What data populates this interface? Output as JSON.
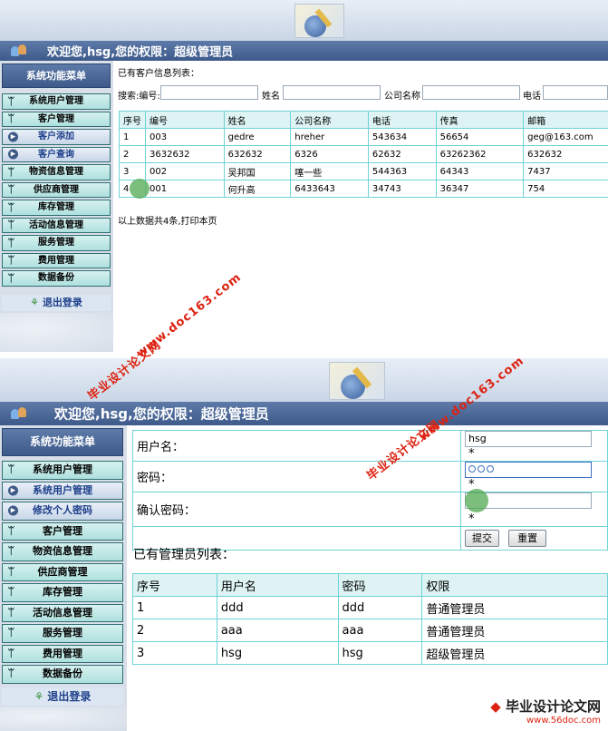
{
  "top": {
    "welcome": "欢迎您,hsg,您的权限：超级管理员",
    "sidebar_title": "系统功能菜单",
    "menu": [
      {
        "label": "系统用户管理",
        "style": "green"
      },
      {
        "label": "客户管理",
        "style": "green"
      },
      {
        "label": "客户添加",
        "style": "blue"
      },
      {
        "label": "客户查询",
        "style": "blue"
      },
      {
        "label": "物资信息管理",
        "style": "green"
      },
      {
        "label": "供应商管理",
        "style": "green"
      },
      {
        "label": "库存管理",
        "style": "green"
      },
      {
        "label": "活动信息管理",
        "style": "green"
      },
      {
        "label": "服务管理",
        "style": "green"
      },
      {
        "label": "费用管理",
        "style": "green"
      },
      {
        "label": "数据备份",
        "style": "green"
      }
    ],
    "logout": "退出登录",
    "list_title": "已有客户信息列表：",
    "search": {
      "code_label": "搜索:编号:",
      "name_label": "姓名",
      "company_label": "公司名称",
      "phone_label": "电话"
    },
    "table": {
      "headers": [
        "序号",
        "编号",
        "姓名",
        "公司名称",
        "电话",
        "传真",
        "邮箱"
      ],
      "rows": [
        [
          "1",
          "003",
          "gedre",
          "hreher",
          "543634",
          "56654",
          "geg@163.com"
        ],
        [
          "2",
          "3632632",
          "632632",
          "6326",
          "62632",
          "63262362",
          "632632"
        ],
        [
          "3",
          "002",
          "吴邦国",
          "噻一些",
          "544363",
          "64343",
          "7437"
        ],
        [
          "4",
          "001",
          "何升高",
          "6433643",
          "34743",
          "36347",
          "754"
        ]
      ]
    },
    "footer": "以上数据共4条,打印本页"
  },
  "bottom": {
    "welcome": "欢迎您,hsg,您的权限：超级管理员",
    "sidebar_title": "系统功能菜单",
    "menu": [
      {
        "label": "系统用户管理",
        "style": "green"
      },
      {
        "label": "系统用户管理",
        "style": "blue"
      },
      {
        "label": "修改个人密码",
        "style": "blue"
      },
      {
        "label": "客户管理",
        "style": "green"
      },
      {
        "label": "物资信息管理",
        "style": "green"
      },
      {
        "label": "供应商管理",
        "style": "green"
      },
      {
        "label": "库存管理",
        "style": "green"
      },
      {
        "label": "活动信息管理",
        "style": "green"
      },
      {
        "label": "服务管理",
        "style": "green"
      },
      {
        "label": "费用管理",
        "style": "green"
      },
      {
        "label": "数据备份",
        "style": "green"
      }
    ],
    "logout": "退出登录",
    "form": {
      "username_label": "用户名：",
      "username_value": "hsg",
      "password_label": "密码：",
      "confirm_label": "确认密码：",
      "required_mark": "*",
      "submit": "提交",
      "reset": "重置"
    },
    "list_title": "已有管理员列表：",
    "table": {
      "headers": [
        "序号",
        "用户名",
        "密码",
        "权限"
      ],
      "rows": [
        [
          "1",
          "ddd",
          "ddd",
          "普通管理员"
        ],
        [
          "2",
          "aaa",
          "aaa",
          "普通管理员"
        ],
        [
          "3",
          "hsg",
          "hsg",
          "超级管理员"
        ]
      ]
    }
  },
  "watermarks": {
    "site_cn": "毕业设计论文网",
    "site_url": "www.doc163.com",
    "footer_url": "www.56doc.com"
  },
  "colors": {
    "accent": "#3d5a8a",
    "menu_green": "#aee0de",
    "table_border": "#6fd3d6",
    "watermark": "#dd2211"
  }
}
